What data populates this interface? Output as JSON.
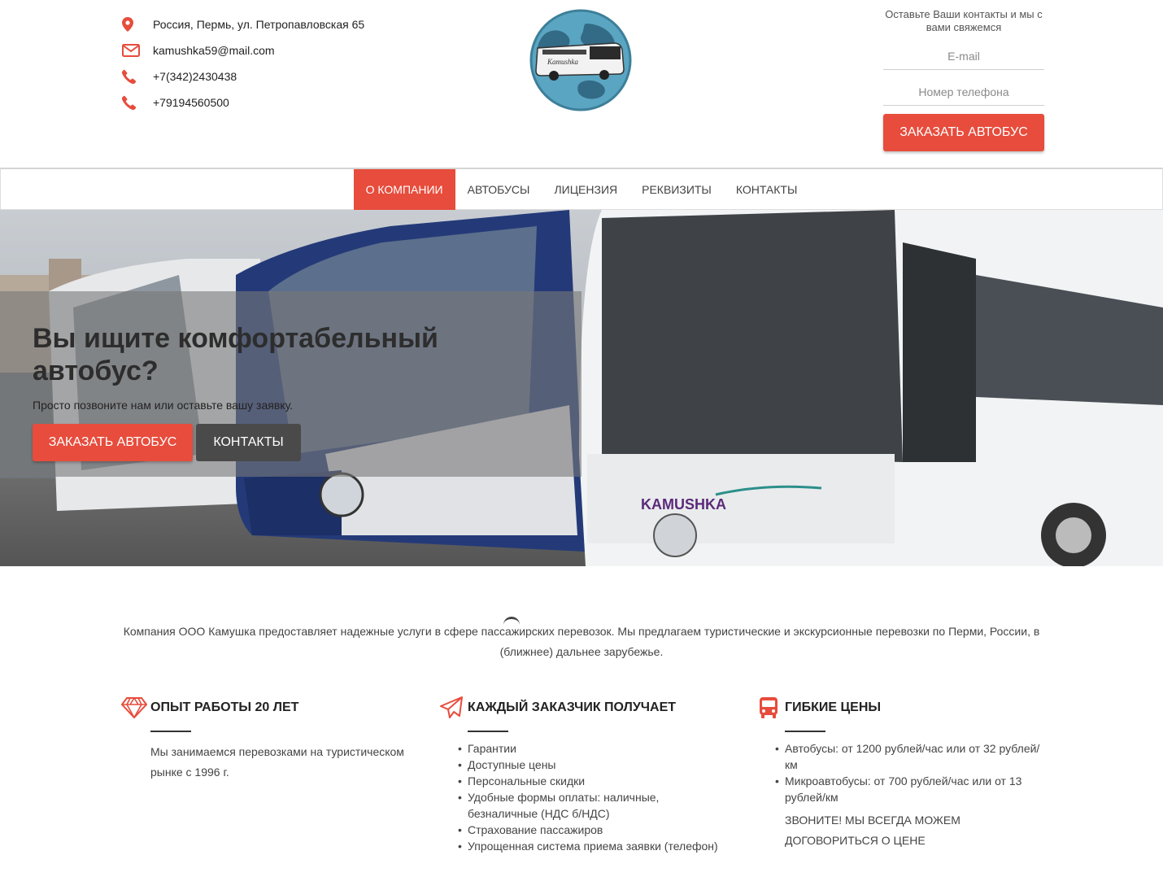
{
  "header": {
    "contacts": [
      {
        "icon": "location-pin-icon",
        "text": "Россия, Пермь, ул. Петропавловская 65"
      },
      {
        "icon": "mail-icon",
        "text": "kamushka59@mail.com"
      },
      {
        "icon": "phone-icon",
        "text": "+7(342)2430438"
      },
      {
        "icon": "phone-icon",
        "text": "+79194560500"
      }
    ],
    "logo_text": "Kamushka",
    "callback": {
      "title": "Оставьте Ваши контакты и мы с вами свяжемся",
      "email_placeholder": "E-mail",
      "phone_placeholder": "Номер телефона",
      "button_label": "ЗАКАЗАТЬ АВТОБУС"
    }
  },
  "nav": {
    "items": [
      "О КОМПАНИИ",
      "АВТОБУСЫ",
      "ЛИЦЕНЗИЯ",
      "РЕКВИЗИТЫ",
      "КОНТАКТЫ"
    ],
    "active_index": 0
  },
  "hero": {
    "title": "Вы ищите комфортабельный автобус?",
    "subtitle": "Просто позвоните нам или оставьте вашу заявку.",
    "order_button": "ЗАКАЗАТЬ АВТОБУС",
    "contacts_button": "КОНТАКТЫ",
    "bus_brand_text": "KAMUSHKA"
  },
  "about": {
    "text": "Компания ООО Камушка предоставляет надежные услуги в сфере пассажирских перевозок. Мы предлагаем туристические и экскурсионные перевозки по Перми, России, в (ближнее) дальнее зарубежье."
  },
  "features": [
    {
      "icon": "diamond-icon",
      "title": "ОПЫТ РАБОТЫ 20 ЛЕТ",
      "body": "Мы занимаемся перевозками на туристическом рынке с 1996 г."
    },
    {
      "icon": "paper-plane-icon",
      "title": "КАЖДЫЙ ЗАКАЗЧИК ПОЛУЧАЕТ",
      "items": [
        "Гарантии",
        "Доступные цены",
        "Персональные скидки",
        "Удобные формы оплаты: наличные, безналичные (НДС б/НДС)",
        "Страхование пассажиров",
        "Упрощенная система приема заявки (телефон)"
      ]
    },
    {
      "icon": "bus-icon",
      "title": "ГИБКИЕ ЦЕНЫ",
      "items": [
        "Автобусы: от 1200 рублей/час или от 32 рублей/км",
        "Микроавтобусы: от 700 рублей/час или от 13 рублей/км"
      ],
      "note": "ЗВОНИТЕ! МЫ ВСЕГДА МОЖЕМ ДОГОВОРИТЬСЯ О ЦЕНЕ"
    }
  ],
  "colors": {
    "accent": "#e74c3c",
    "dark_button": "#4a4a4a",
    "logo_circle": "#5aa5c2"
  }
}
